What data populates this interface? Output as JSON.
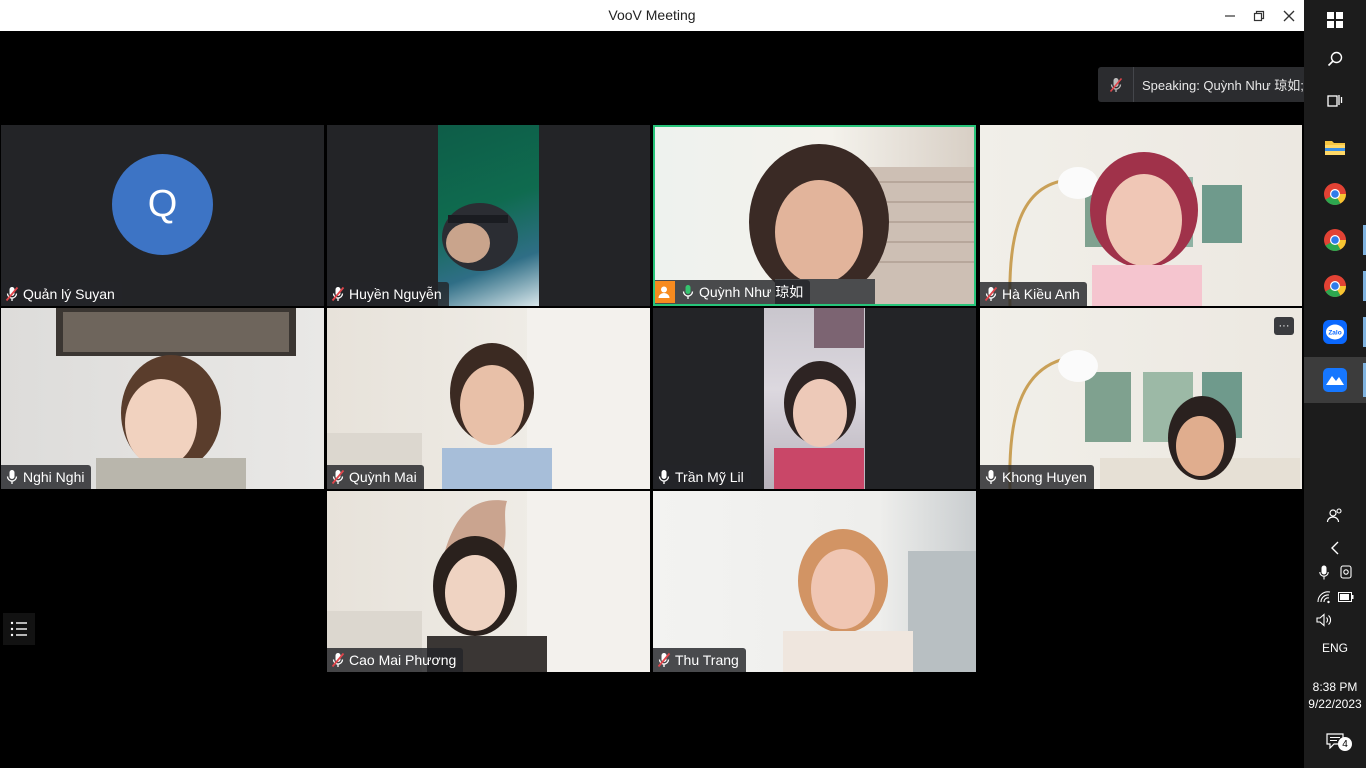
{
  "window": {
    "title": "VooV Meeting"
  },
  "speaking": {
    "text": "Speaking: Quỳnh Như 琼如;"
  },
  "participants": [
    {
      "name": "Quản lý Suyan",
      "mic": "muted",
      "avatar_letter": "Q"
    },
    {
      "name": "Huyền Nguyễn",
      "mic": "muted"
    },
    {
      "name": "Quỳnh Như 琼如",
      "mic": "on",
      "host": true,
      "active_speaker": true
    },
    {
      "name": "Hà Kiều Anh",
      "mic": "muted"
    },
    {
      "name": "Nghi Nghi",
      "mic": "on"
    },
    {
      "name": "Quỳnh Mai",
      "mic": "muted"
    },
    {
      "name": "Trần Mỹ Lil",
      "mic": "on"
    },
    {
      "name": "Khong Huyen",
      "mic": "on"
    },
    {
      "name": "Cao Mai Phương",
      "mic": "muted"
    },
    {
      "name": "Thu Trang",
      "mic": "muted"
    }
  ],
  "tile_more_label": "···",
  "taskbar": {
    "language": "ENG",
    "time": "8:38 PM",
    "date": "9/22/2023",
    "notification_count": "4",
    "apps": [
      "windows-start",
      "search",
      "task-view",
      "file-explorer",
      "chrome",
      "chrome",
      "chrome",
      "zalo",
      "voov-meeting"
    ]
  },
  "colors": {
    "active_speaker_border": "#27c47a",
    "avatar": "#3d74c5",
    "host_badge": "#f78b1f",
    "muted_mic": "#e0454b"
  }
}
